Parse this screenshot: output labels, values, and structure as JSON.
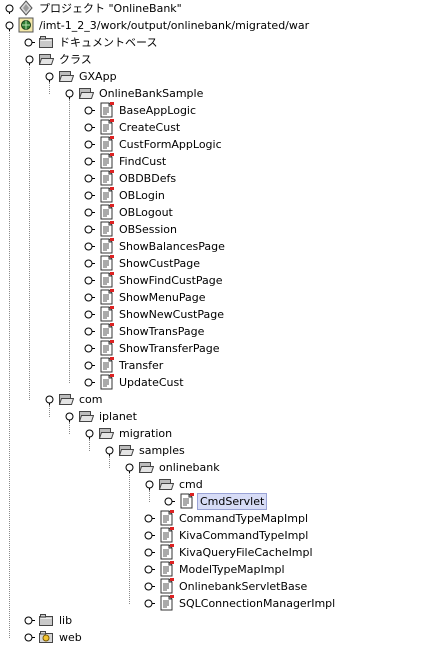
{
  "tree": {
    "project_label": "プロジェクト \"OnlineBank\"",
    "root_path": "/imt-1_2_3/work/output/onlinebank/migrated/war",
    "document_base": "ドキュメントベース",
    "classes": "クラス",
    "gxapp": "GXApp",
    "onlinebanksample": "OnlineBankSample",
    "sample_files": [
      "BaseAppLogic",
      "CreateCust",
      "CustFormAppLogic",
      "FindCust",
      "OBDBDefs",
      "OBLogin",
      "OBLogout",
      "OBSession",
      "ShowBalancesPage",
      "ShowCustPage",
      "ShowFindCustPage",
      "ShowMenuPage",
      "ShowNewCustPage",
      "ShowTransPage",
      "ShowTransferPage",
      "Transfer",
      "UpdateCust"
    ],
    "com": "com",
    "iplanet": "iplanet",
    "migration": "migration",
    "samples": "samples",
    "onlinebank": "onlinebank",
    "cmd": "cmd",
    "cmd_files": [
      "CmdServlet"
    ],
    "onlinebank_files": [
      "CommandTypeMapImpl",
      "KivaCommandTypeImpl",
      "KivaQueryFileCacheImpl",
      "ModelTypeMapImpl",
      "OnlinebankServletBase",
      "SQLConnectionManagerImpl"
    ],
    "lib": "lib",
    "web": "web",
    "selected": "CmdServlet"
  }
}
